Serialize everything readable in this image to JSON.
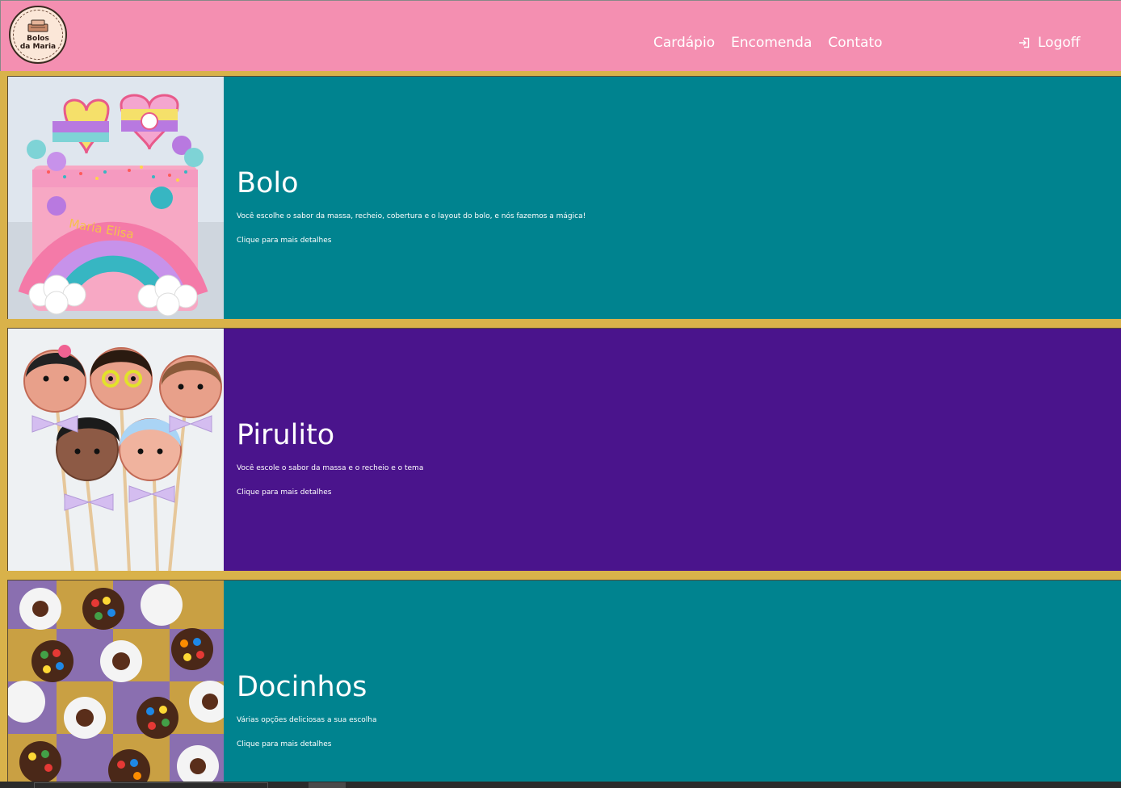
{
  "brand": {
    "logo_text_line1": "Bolos",
    "logo_text_line2": "da Maria"
  },
  "nav": {
    "items": [
      {
        "label": "Cardápio"
      },
      {
        "label": "Encomenda"
      },
      {
        "label": "Contato"
      }
    ],
    "logoff_label": "Logoff"
  },
  "colors": {
    "navbar": "#f48fb1",
    "background": "#d9b24a",
    "teal": "#00838f",
    "purple": "#4a148c"
  },
  "cards": [
    {
      "title": "Bolo",
      "text": "Você escolhe o sabor da massa, recheio, cobertura e o layout do bolo, e nós fazemos a mágica!",
      "link": "Clique para mais detalhes",
      "image_name": "rainbow-cake-photo"
    },
    {
      "title": "Pirulito",
      "text": "Você escole o sabor da massa e o recheio e o tema",
      "link": "Clique para mais detalhes",
      "image_name": "character-lollipops-photo"
    },
    {
      "title": "Docinhos",
      "text": "Várias opções deliciosas a sua escolha",
      "link": "Clique para mais detalhes",
      "image_name": "brigadeiros-photo"
    }
  ]
}
